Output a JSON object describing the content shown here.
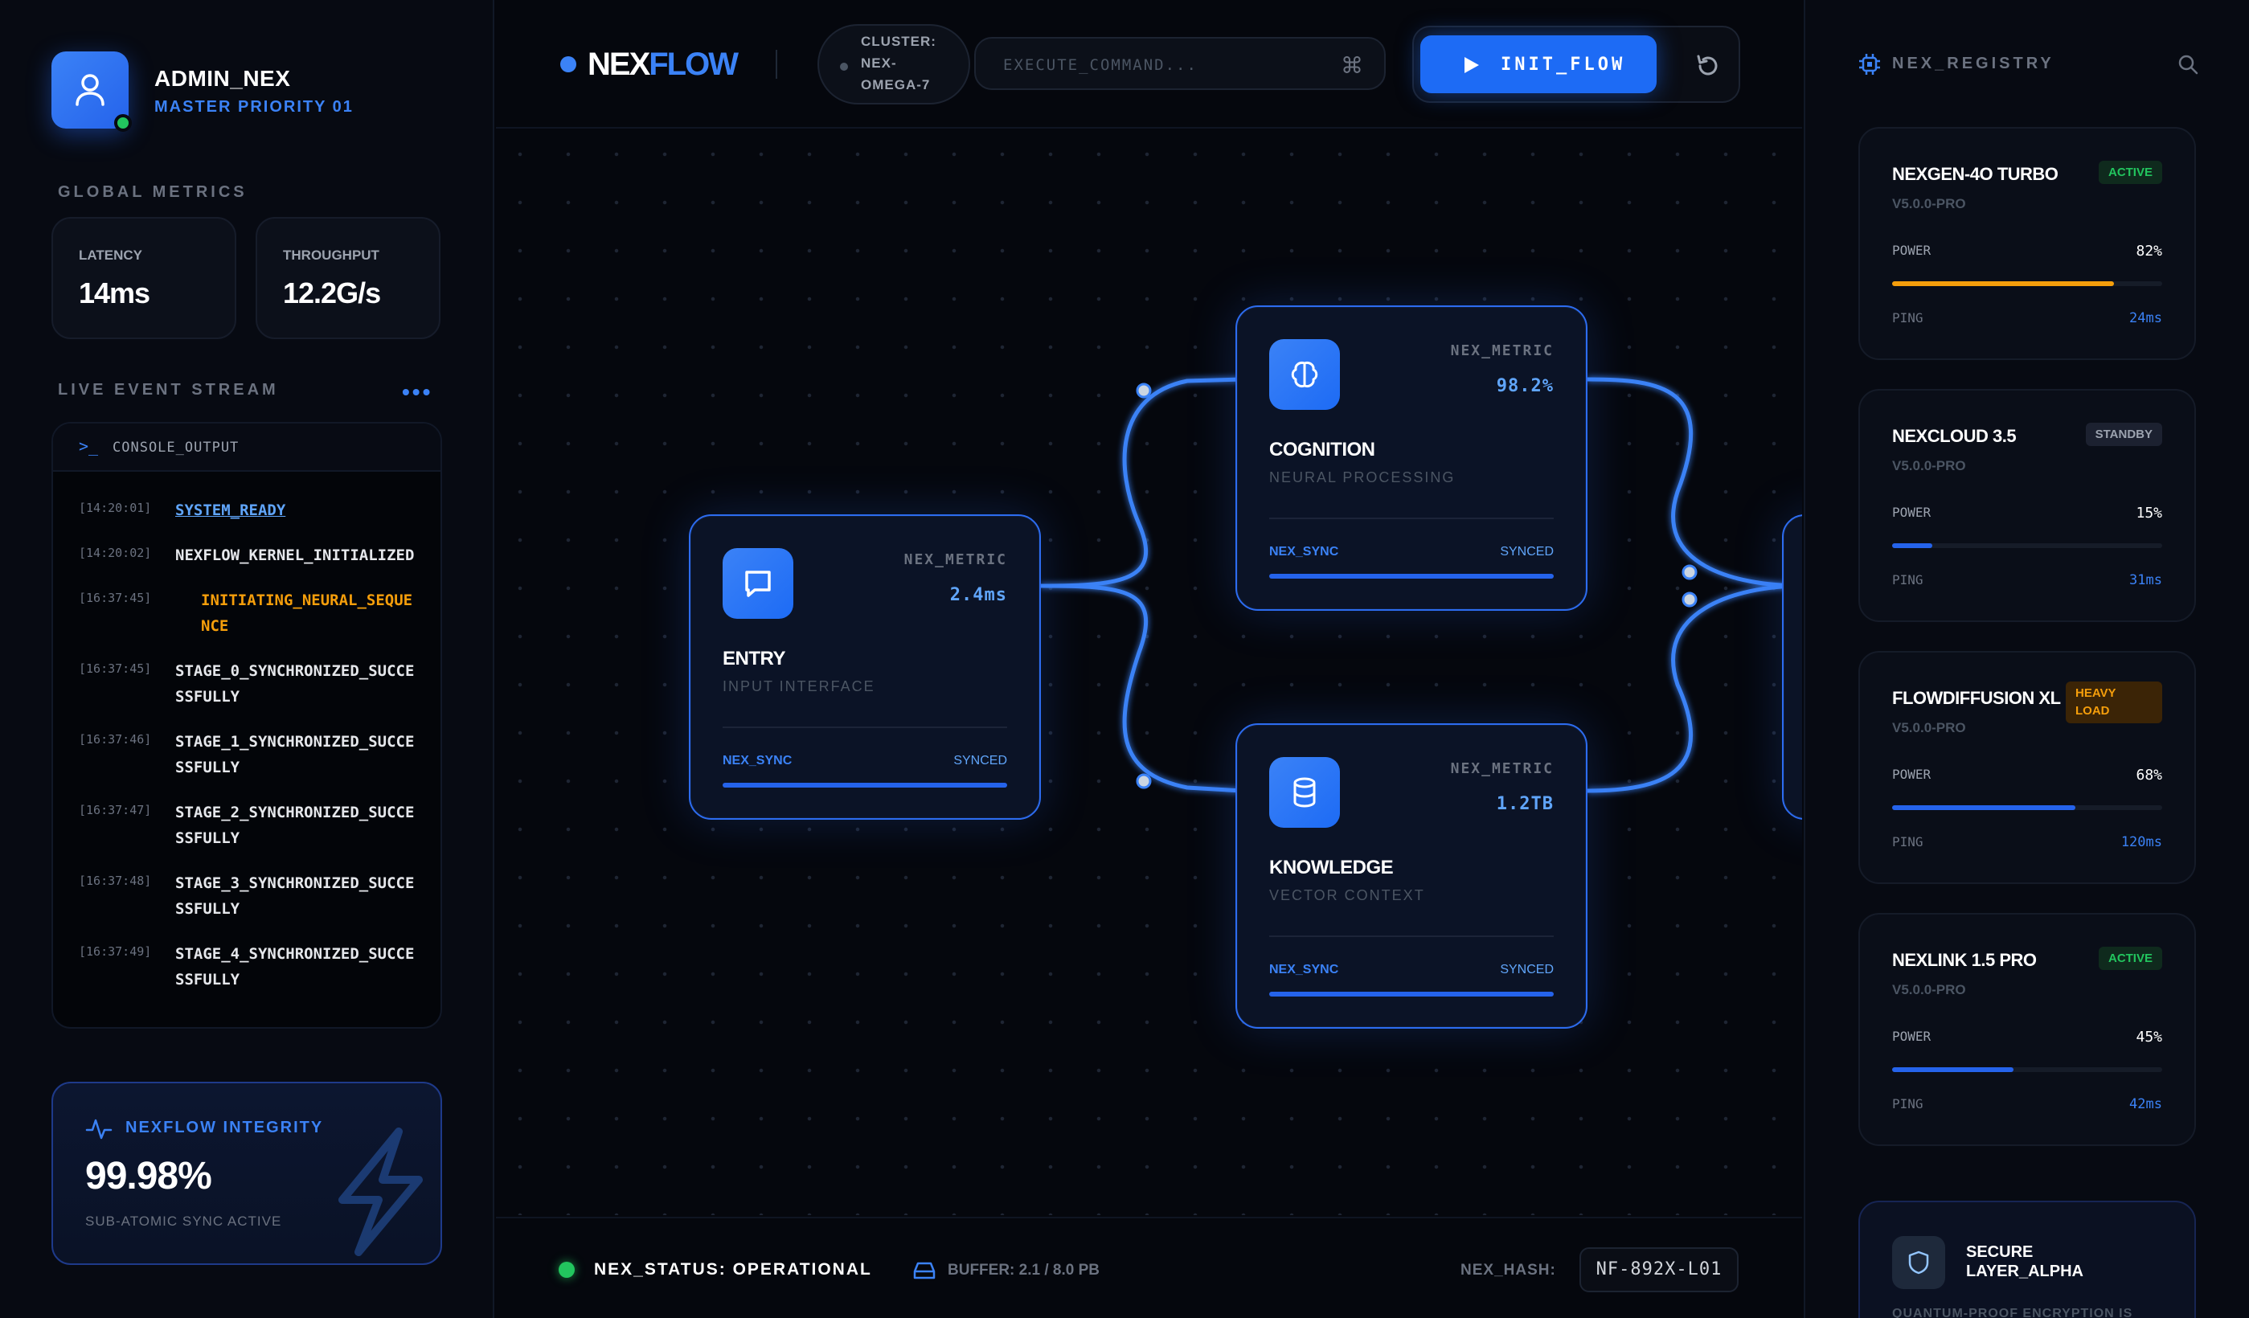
{
  "user": {
    "name": "ADMIN_NEX",
    "role": "MASTER PRIORITY 01"
  },
  "metrics": {
    "title": "GLOBAL METRICS",
    "latency": {
      "label": "LATENCY",
      "value": "14ms"
    },
    "throughput": {
      "label": "THROUGHPUT",
      "value": "12.2G/s"
    }
  },
  "stream": {
    "title": "LIVE EVENT STREAM",
    "more": "•••",
    "console_prompt": ">_",
    "console_title": "CONSOLE_OUTPUT",
    "logs": [
      {
        "ts": "[14:20:01]",
        "msg": "SYSTEM_READY"
      },
      {
        "ts": "[14:20:02]",
        "msg": "NEXFLOW_KERNEL_INITIALIZED"
      },
      {
        "ts": "[16:37:45]",
        "msg": "INITIATING_NEURAL_SEQUENCE"
      },
      {
        "ts": "[16:37:45]",
        "msg": "STAGE_0_SYNCHRONIZED_SUCCESSFULLY"
      },
      {
        "ts": "[16:37:46]",
        "msg": "STAGE_1_SYNCHRONIZED_SUCCESSFULLY"
      },
      {
        "ts": "[16:37:47]",
        "msg": "STAGE_2_SYNCHRONIZED_SUCCESSFULLY"
      },
      {
        "ts": "[16:37:48]",
        "msg": "STAGE_3_SYNCHRONIZED_SUCCESSFULLY"
      },
      {
        "ts": "[16:37:49]",
        "msg": "STAGE_4_SYNCHRONIZED_SUCCESSFULLY"
      }
    ]
  },
  "integrity": {
    "title": "NEXFLOW INTEGRITY",
    "value": "99.98%",
    "subtitle": "SUB-ATOMIC SYNC ACTIVE"
  },
  "header": {
    "brand_part1": "NEX",
    "brand_part2": "FLOW",
    "cluster": "CLUSTER: NEX-OMEGA-7",
    "command_placeholder": "EXECUTE_COMMAND...",
    "command_shortcut": "⌘",
    "run_label": "INIT_FLOW"
  },
  "nodes": {
    "entry": {
      "metric_label": "NEX_METRIC",
      "metric_value": "2.4ms",
      "title": "ENTRY",
      "subtitle": "INPUT INTERFACE",
      "sync_label": "NEX_SYNC",
      "sync_status": "SYNCED"
    },
    "cognition": {
      "metric_label": "NEX_METRIC",
      "metric_value": "98.2%",
      "title": "COGNITION",
      "subtitle": "NEURAL PROCESSING",
      "sync_label": "NEX_SYNC",
      "sync_status": "SYNCED"
    },
    "knowledge": {
      "metric_label": "NEX_METRIC",
      "metric_value": "1.2TB",
      "title": "KNOWLEDGE",
      "subtitle": "VECTOR CONTEXT",
      "sync_label": "NEX_SYNC",
      "sync_status": "SYNCED"
    }
  },
  "footer": {
    "status": "NEX_STATUS: OPERATIONAL",
    "buffer": "BUFFER: 2.1 / 8.0 PB",
    "hash_label": "NEX_HASH:",
    "hash_value": "NF-892X-L01"
  },
  "registry": {
    "title": "NEX_REGISTRY",
    "power_label": "POWER",
    "ping_label": "PING",
    "models": [
      {
        "name": "NEXGEN-4O TURBO",
        "version": "V5.0.0-PRO",
        "badge": "ACTIVE",
        "power": "82%",
        "power_fraction": 0.82,
        "power_color": "#f59e0b",
        "ping": "24ms"
      },
      {
        "name": "NEXCLOUD 3.5",
        "version": "V5.0.0-PRO",
        "badge": "STANDBY",
        "power": "15%",
        "power_fraction": 0.15,
        "power_color": "#2563eb",
        "ping": "31ms"
      },
      {
        "name": "FLOWDIFFUSION XL",
        "version": "V5.0.0-PRO",
        "badge": "HEAVY LOAD",
        "power": "68%",
        "power_fraction": 0.68,
        "power_color": "#2563eb",
        "ping": "120ms"
      },
      {
        "name": "NEXLINK 1.5 PRO",
        "version": "V5.0.0-PRO",
        "badge": "ACTIVE",
        "power": "45%",
        "power_fraction": 0.45,
        "power_color": "#2563eb",
        "ping": "42ms"
      }
    ],
    "secure": {
      "title": "SECURE LAYER_ALPHA",
      "subtitle": "QUANTUM-PROOF ENCRYPTION IS"
    }
  }
}
